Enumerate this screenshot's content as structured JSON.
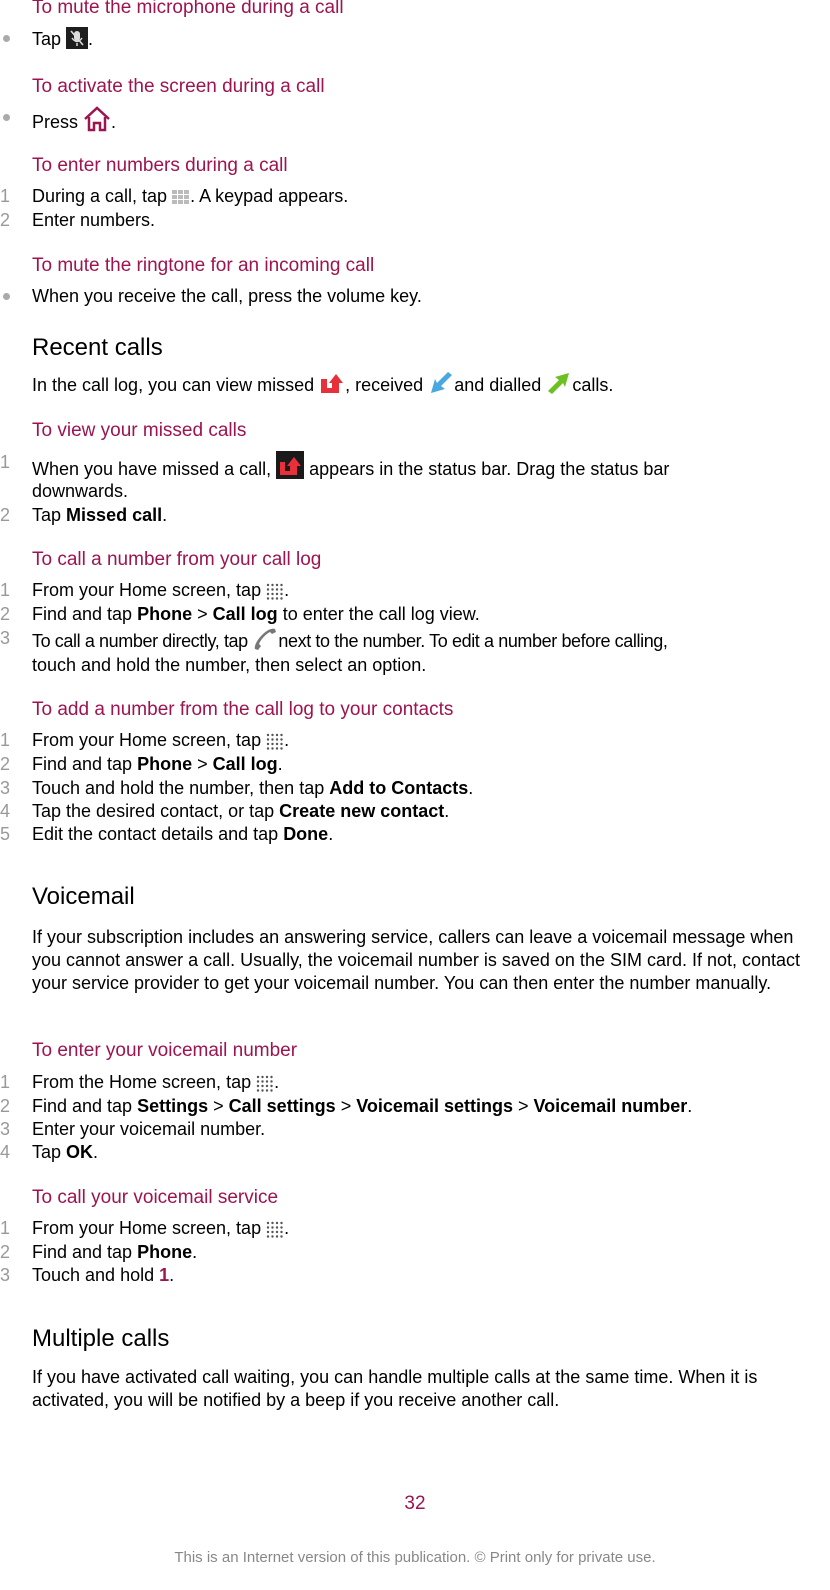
{
  "sections": {
    "mute_mic": {
      "title": "To mute the microphone during a call",
      "items": [
        {
          "marker": "bullet",
          "pre": "Tap",
          "icon": "mute-microphone-icon",
          "post": "."
        }
      ]
    },
    "activate_screen": {
      "title": "To activate the screen during a call",
      "items": [
        {
          "marker": "bullet",
          "pre": "Press",
          "icon": "home-icon",
          "post": "."
        }
      ]
    },
    "enter_numbers": {
      "title": "To enter numbers during a call",
      "items": [
        {
          "marker": "1",
          "pre": "During a call, tap",
          "icon": "keypad-icon",
          "post": ". A keypad appears."
        },
        {
          "marker": "2",
          "text": "Enter numbers."
        }
      ]
    },
    "mute_ringtone": {
      "title": "To mute the ringtone for an incoming call",
      "items": [
        {
          "marker": "bullet",
          "text": "When you receive the call, press the volume key."
        }
      ]
    },
    "recent_calls": {
      "heading": "Recent calls",
      "intro_1": "In the call log, you can view missed",
      "intro_2": ", received",
      "intro_3": "and dialled",
      "intro_4": "calls."
    },
    "view_missed": {
      "title": "To view your missed calls",
      "item1_pre": "When you have missed a call,",
      "item1_post": "appears in the status bar. Drag the status bar",
      "item1_cont": "downwards.",
      "item2_pre": "Tap",
      "item2_bold": "Missed call",
      "item2_post": ".",
      "markers": [
        "1",
        "2"
      ]
    },
    "call_from_log": {
      "title": "To call a number from your call log",
      "markers": [
        "1",
        "2",
        "3"
      ],
      "item1_pre": "From your Home screen, tap",
      "item1_post": ".",
      "item2_pre": "Find and tap",
      "item2_b1": "Phone",
      "item2_sep": ">",
      "item2_b2": "Call log",
      "item2_post": "to enter the call log view.",
      "item3_pre": "To call a number directly, tap",
      "item3_post": "next to the number. To edit a number before calling,",
      "item3_cont": "touch and hold the number, then select an option."
    },
    "add_to_contacts": {
      "title": "To add a number from the call log to your contacts",
      "markers": [
        "1",
        "2",
        "3",
        "4",
        "5"
      ],
      "item1_pre": "From your Home screen, tap",
      "item1_post": ".",
      "item2_pre": "Find and tap",
      "item2_b1": "Phone",
      "item2_sep": ">",
      "item2_b2": "Call log",
      "item2_post": ".",
      "item3_pre": "Touch and hold the number, then tap",
      "item3_bold": "Add to Contacts",
      "item3_post": ".",
      "item4_pre": "Tap the desired contact, or tap",
      "item4_bold": "Create new contact",
      "item4_post": ".",
      "item5_pre": "Edit the contact details and tap",
      "item5_bold": "Done",
      "item5_post": "."
    },
    "voicemail": {
      "heading": "Voicemail",
      "paragraph": "If your subscription includes an answering service, callers can leave a voicemail message when you cannot answer a call. Usually, the voicemail number is saved on the SIM card. If not, contact your service provider to get your voicemail number. You can then enter the number manually."
    },
    "enter_voicemail": {
      "title": "To enter your voicemail number",
      "markers": [
        "1",
        "2",
        "3",
        "4"
      ],
      "item1_pre": "From the Home screen, tap",
      "item1_post": ".",
      "item2_pre": "Find and tap",
      "item2_b1": "Settings",
      "item2_b2": "Call settings",
      "item2_b3": "Voicemail settings",
      "item2_b4": "Voicemail number",
      "item2_sep": ">",
      "item2_post": ".",
      "item3": "Enter your voicemail number.",
      "item4_pre": "Tap",
      "item4_bold": "OK",
      "item4_post": "."
    },
    "call_voicemail": {
      "title": "To call your voicemail service",
      "markers": [
        "1",
        "2",
        "3"
      ],
      "item1_pre": "From your Home screen, tap",
      "item1_post": ".",
      "item2_pre": "Find and tap",
      "item2_bold": "Phone",
      "item2_post": ".",
      "item3_pre": "Touch and hold",
      "item3_key": "1",
      "item3_post": "."
    },
    "multiple_calls": {
      "heading": "Multiple calls",
      "paragraph": "If you have activated call waiting, you can handle multiple calls at the same time. When it is activated, you will be notified by a beep if you receive another call."
    }
  },
  "footer": {
    "page_number": "32",
    "note": "This is an Internet version of this publication. © Print only for private use."
  },
  "colors": {
    "accent": "#9c1450",
    "marker": "#999999",
    "missed": "#e8303a",
    "received": "#4aa8e0",
    "dialled": "#6cc020"
  }
}
